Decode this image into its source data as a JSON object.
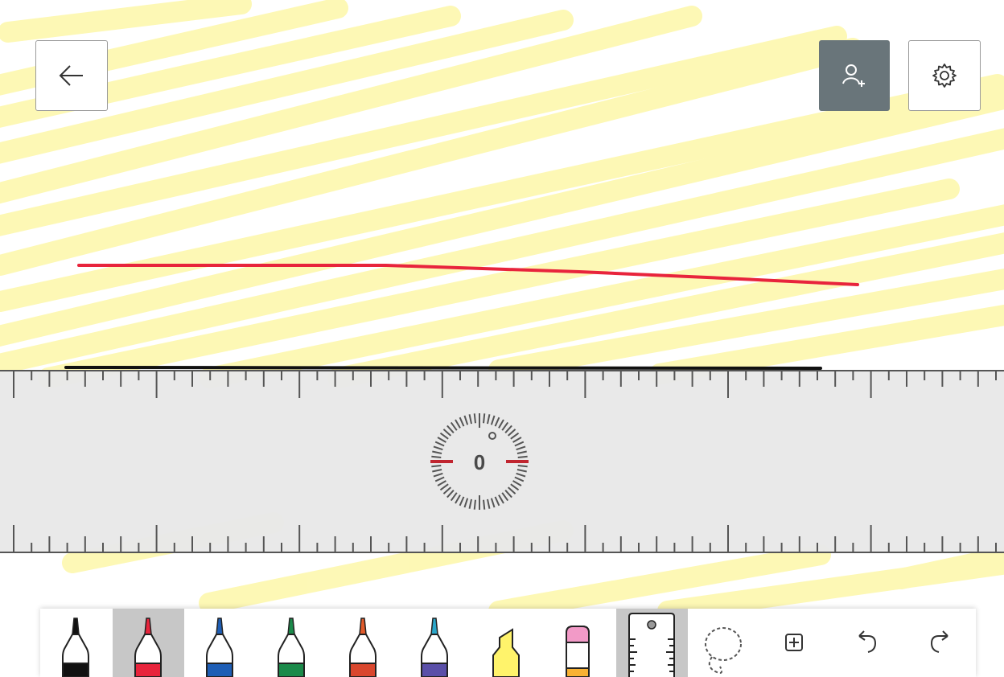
{
  "ruler": {
    "angle_label": "0"
  },
  "colors": {
    "highlight": "#fdf8b2",
    "red_ink": "#e8243c",
    "black_ink": "#111111",
    "ruler": "#e8e8e8",
    "dial_marker": "#c0252f",
    "button_active_bg": "#69757a"
  },
  "top_bar": {
    "back_icon": "arrow-left-icon",
    "invite_icon": "add-person-icon",
    "settings_icon": "gear-icon"
  },
  "toolbar": {
    "pens": [
      {
        "name": "black-pen",
        "cap": "#111111",
        "body": "#111111"
      },
      {
        "name": "red-pen",
        "cap": "#e8243c",
        "body": "#e8243c",
        "selected": true
      },
      {
        "name": "blue-pen",
        "cap": "#1e5eb5",
        "body": "#1e5eb5"
      },
      {
        "name": "green-pen",
        "cap": "#1b8a4a",
        "body": "#1b8a4a"
      },
      {
        "name": "rainbow-pen",
        "cap": "#e05a2a",
        "body": "#d9472e"
      },
      {
        "name": "galaxy-pen",
        "cap": "#2aa6c9",
        "body": "#5a4fa8"
      },
      {
        "name": "yellow-highlighter",
        "cap": "#fff36b",
        "body": "#fff36b"
      },
      {
        "name": "eraser",
        "cap": "#f29ac7",
        "body": "#f9b233"
      }
    ],
    "ruler_icon": "ruler-icon",
    "lasso_icon": "lasso-select-icon",
    "add_icon": "add-box-icon",
    "undo_icon": "undo-icon",
    "redo_icon": "redo-icon"
  }
}
